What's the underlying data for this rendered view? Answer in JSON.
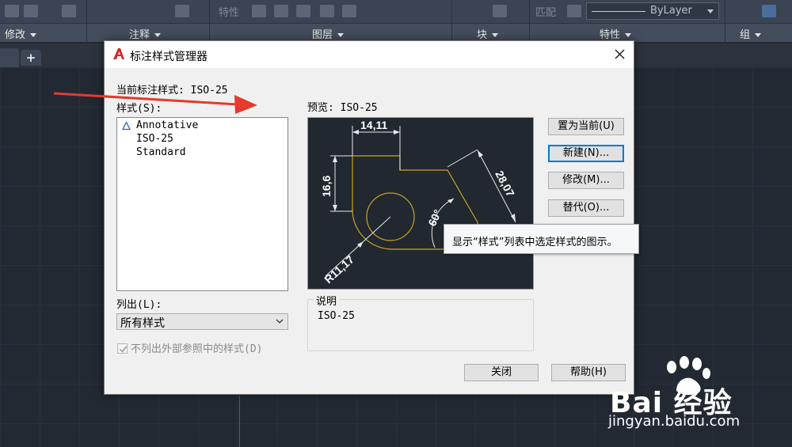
{
  "ribbon": {
    "panels": [
      "修改",
      "注释",
      "图层",
      "块",
      "特性",
      "组"
    ],
    "layer_property": "特性",
    "match_property": "匹配",
    "bylayer": "ByLayer"
  },
  "dialog": {
    "title": "标注样式管理器",
    "current_style_label": "当前标注样式: ISO-25",
    "styles_label": "样式(S):",
    "styles": [
      "Annotative",
      "ISO-25",
      "Standard"
    ],
    "preview_label": "预览: ISO-25",
    "list_label": "列出(L):",
    "list_selected": "所有样式",
    "exclude_xref_label": "不列出外部参照中的样式(D)",
    "description_label": "说明",
    "description_value": "ISO-25",
    "buttons": {
      "set_current": "置为当前(U)",
      "new": "新建(N)...",
      "modify": "修改(M)...",
      "override": "替代(O)...",
      "close": "关闭",
      "help": "帮助(H)"
    },
    "tooltip": "显示“样式”列表中选定样式的图示。"
  },
  "preview_dims": {
    "width_dim": "14,11",
    "height_dim": "16,6",
    "slant_dim": "28,07",
    "angle_dim": "60°",
    "radius_dim": "R11,17"
  },
  "watermark": {
    "logo": "Bai 经验",
    "url": "jingyan.baidu.com"
  },
  "colors": {
    "accent_red": "#e53a2c",
    "preview_bg": "#212830",
    "preview_outline": "#c9a227",
    "focus_blue": "#0078d7"
  }
}
